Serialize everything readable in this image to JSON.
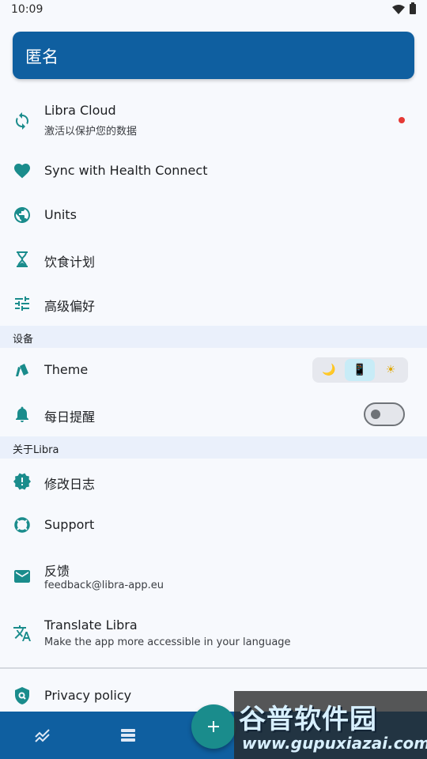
{
  "status_bar": {
    "time": "10:09"
  },
  "profile": {
    "name": "匿名"
  },
  "menu": {
    "libra_cloud": {
      "title": "Libra Cloud",
      "subtitle": "激活以保护您的数据"
    },
    "health_connect": {
      "title": "Sync with Health Connect"
    },
    "units": {
      "title": "Units"
    },
    "diet_plan": {
      "title": "饮食计划"
    },
    "advanced": {
      "title": "高级偏好"
    }
  },
  "sections": {
    "device": "设备",
    "about": "关于Libra"
  },
  "device": {
    "theme": {
      "title": "Theme",
      "options": [
        "🌙",
        "📱",
        "☀"
      ],
      "selected": "📱"
    },
    "daily_reminder": {
      "title": "每日提醒",
      "enabled": false
    }
  },
  "about": {
    "changelog": {
      "title": "修改日志"
    },
    "support": {
      "title": "Support"
    },
    "feedback": {
      "title": "反馈",
      "subtitle": "feedback@libra-app.eu"
    },
    "translate": {
      "title": "Translate Libra",
      "subtitle": "Make the app more accessible in your language"
    },
    "privacy": {
      "title": "Privacy policy"
    }
  },
  "watermark": {
    "brand": "谷普软件园",
    "url": "www.gupuxiazai.com"
  },
  "colors": {
    "primary": "#0f5fa0",
    "accent_teal": "#1a8c8c",
    "notification_dot": "#e53935"
  }
}
